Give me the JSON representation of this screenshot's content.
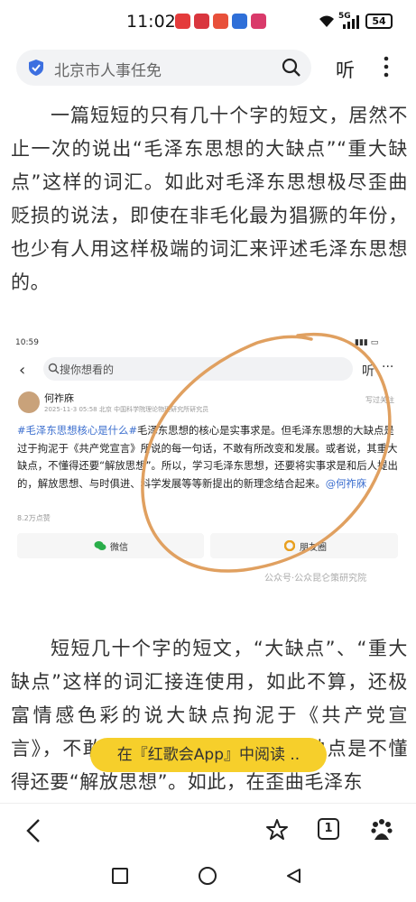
{
  "status_bar": {
    "time": "11:02",
    "signal_label": "5G",
    "battery": "54"
  },
  "search": {
    "query": "北京市人事任免",
    "listen_label": "听"
  },
  "article": {
    "p1": "一篇短短的只有几十个字的短文，居然不止一次的说出“毛泽东思想的大缺点”“重大缺点”这样的词汇。如此对毛泽东思想极尽歪曲贬损的说法，即使在非毛化最为猖獗的年份，也少有人用这样极端的词汇来评述毛泽东思想的。",
    "p2": "短短几十个字的短文，“大缺点”、“重大缺点”这样的词汇接连使用，如此不算，还极富情感色彩的说大缺点拘泥于《共产党宣言》，不敢有所改变和发展。最大缺点是不懂得还要“解放思想”。如此，在歪曲毛泽东"
  },
  "embedded": {
    "time": "10:59",
    "search_placeholder": "搜你想看的",
    "listen_label": "听",
    "more_label": "···",
    "author": "何祚庥",
    "meta": "2025-11-3 05:58 北京 中国科学院理论物理研究所研究员",
    "follow_label": "写过关注",
    "tag": "#毛泽东思想核心是什么#",
    "body": "毛泽东思想的核心是实事求是。但毛泽东思想的大缺点是过于拘泥于《共产党宣言》所说的每一句话，不敢有所改变和发展。或者说，其重大缺点，不懂得还要“解放思想”。所以，学习毛泽东思想，还要将实事求是和后人提出的，解放思想、与时俱进、科学发展等等新提出的新理念结合起来。",
    "mention": "@何祚庥",
    "views": "8.2万点赞",
    "share_wechat": "微信",
    "share_moments": "朋友圈",
    "watermark": "公众号·公众昆仑策研究院"
  },
  "banner": {
    "text": "在『红歌会App』中阅读 .."
  },
  "toolbar": {
    "tab_count": "1"
  },
  "colors": {
    "banner": "#f6cf2b",
    "hashtag": "#3c6fcf",
    "circle": "#e0a060",
    "shield": "#3c6fe0"
  }
}
